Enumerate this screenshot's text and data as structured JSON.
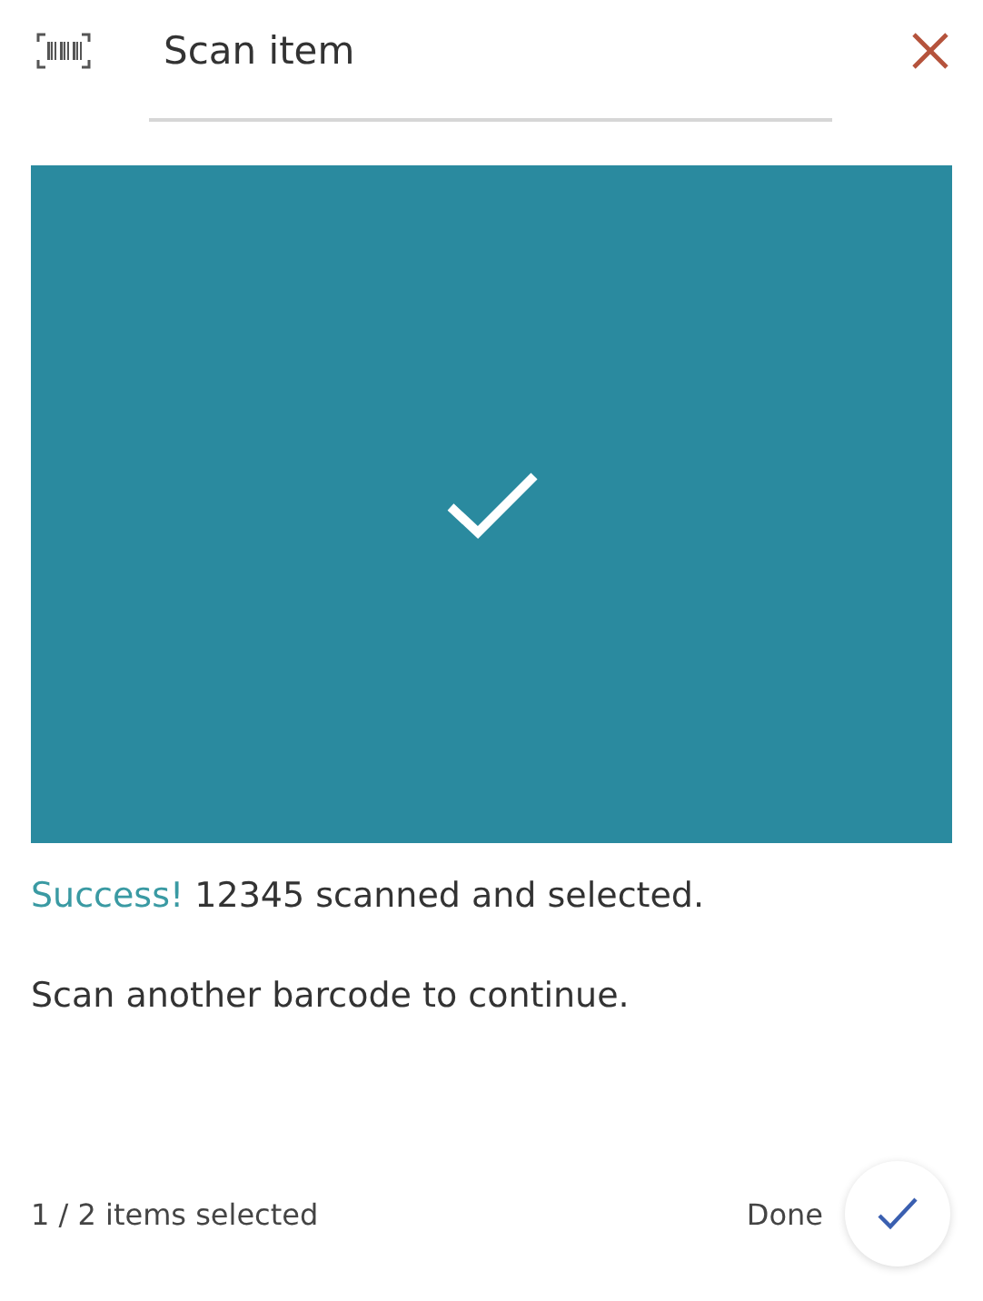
{
  "header": {
    "title": "Scan item"
  },
  "scanner": {
    "success": true
  },
  "message": {
    "highlight": "Success!",
    "text": "12345 scanned and selected."
  },
  "instruction": "Scan another barcode to continue.",
  "footer": {
    "count": "1 / 2 items selected",
    "done_label": "Done"
  }
}
